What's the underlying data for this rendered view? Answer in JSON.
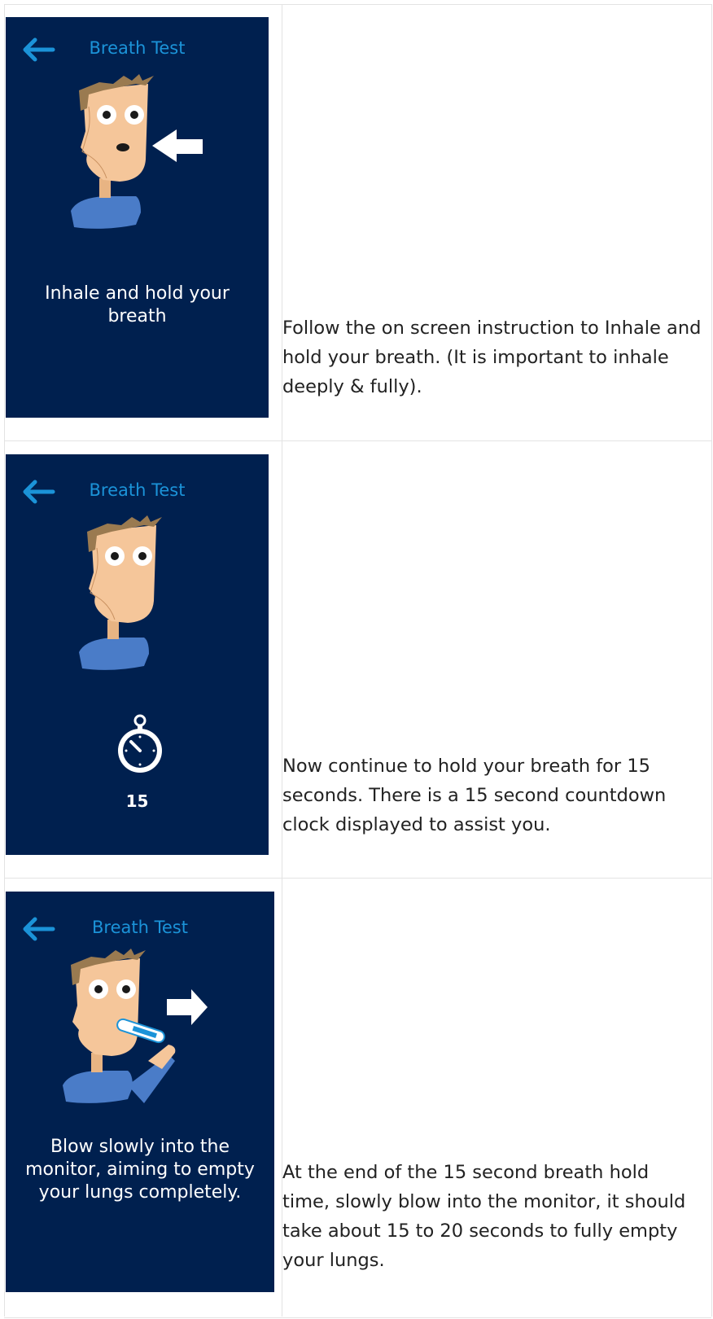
{
  "steps": [
    {
      "screen_title": "Breath Test",
      "screen_message": "Inhale and hold your breath",
      "description": "Follow the on screen instruction to Inhale and hold your breath. (It is important to inhale deeply & fully)."
    },
    {
      "screen_title": "Breath Test",
      "countdown": "15",
      "description": "Now continue to hold your breath for 15 seconds. There is a 15 second countdown clock displayed to assist you."
    },
    {
      "screen_title": "Breath Test",
      "screen_message": "Blow slowly into the monitor, aiming to empty your lungs completely.",
      "description": "At the end of the 15 second breath hold time, slowly blow into the monitor, it should take about 15 to 20 seconds to fully empty your lungs."
    }
  ],
  "icons": {
    "back": "back-arrow-icon",
    "timer": "stopwatch-icon",
    "inhale_arrow": "arrow-left-icon",
    "exhale_arrow": "arrow-right-icon"
  },
  "colors": {
    "screen_background": "#00204f",
    "title_accent": "#1b93d8",
    "text_white": "#ffffff",
    "shirt": "#4a7cc8",
    "skin": "#f5c69a",
    "hair": "#9a7a50"
  }
}
